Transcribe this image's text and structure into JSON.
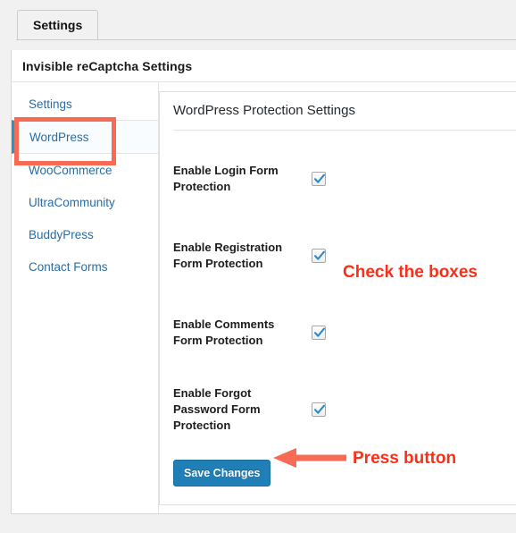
{
  "tabs": [
    {
      "label": "Settings",
      "active": true
    }
  ],
  "card": {
    "title": "Invisible reCaptcha Settings"
  },
  "sidebar": {
    "items": [
      {
        "label": "Settings",
        "active": false
      },
      {
        "label": "WordPress",
        "active": true
      },
      {
        "label": "WooCommerce",
        "active": false
      },
      {
        "label": "UltraCommunity",
        "active": false
      },
      {
        "label": "BuddyPress",
        "active": false
      },
      {
        "label": "Contact Forms",
        "active": false
      }
    ]
  },
  "panel": {
    "title": "WordPress Protection Settings",
    "rows": [
      {
        "label": "Enable Login Form Protection",
        "checked": true
      },
      {
        "label": "Enable Registration Form Protection",
        "checked": true
      },
      {
        "label": "Enable Comments Form Protection",
        "checked": true
      },
      {
        "label": "Enable Forgot Password Form Protection",
        "checked": true
      }
    ],
    "save_label": "Save Changes"
  },
  "annotations": {
    "check_boxes": "Check the boxes",
    "press_button": "Press button",
    "arrow": "left-arrow-icon",
    "highlight": "red-highlight-box"
  },
  "colors": {
    "annotation_text": "#f92f17",
    "annotation_arrow": "#f96a55",
    "highlight_border": "#f96a55",
    "primary_button": "#1f7fb6",
    "link": "#2b6ca3",
    "active_marker": "#2a95c5",
    "checkmark": "#2a8cc4"
  }
}
